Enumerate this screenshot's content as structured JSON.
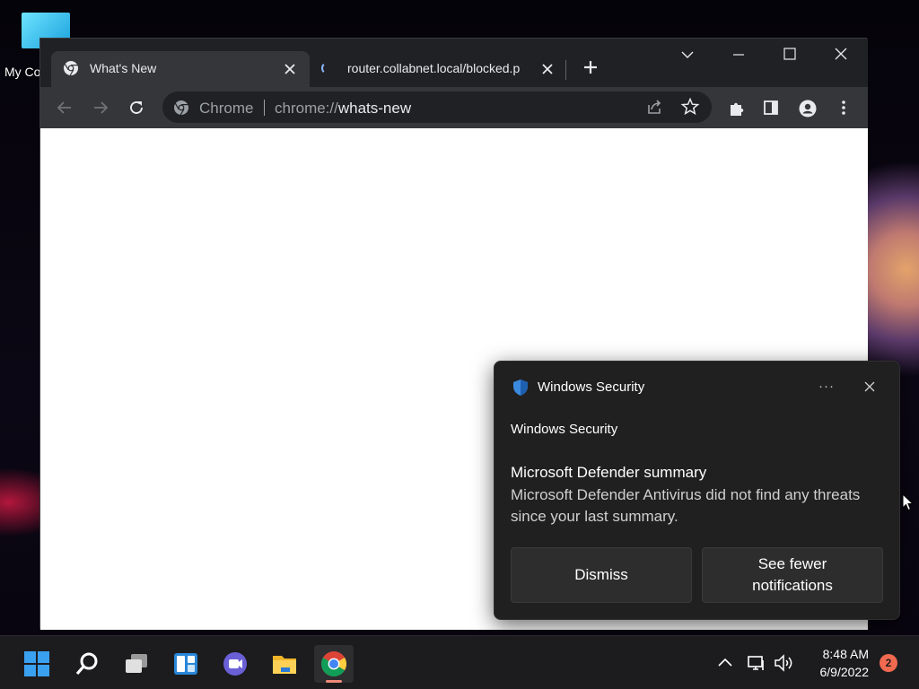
{
  "desktop": {
    "icon_label": "My Co"
  },
  "browser": {
    "tabs": [
      {
        "title": "What's New",
        "active": true
      },
      {
        "title": "router.collabnet.local/blocked.p",
        "active": false
      }
    ],
    "omnibox": {
      "chip": "Chrome",
      "url_scheme": "chrome://",
      "url_host": "whats-new"
    }
  },
  "notification": {
    "app_name": "Windows Security",
    "source": "Windows Security",
    "headline": "Microsoft Defender summary",
    "body": "Microsoft Defender Antivirus did not find any threats since your last summary.",
    "more_label": "···",
    "buttons": {
      "dismiss": "Dismiss",
      "fewer": "See fewer notifications"
    }
  },
  "taskbar": {
    "apps": [
      "start-icon",
      "search-icon",
      "task-view-icon",
      "widgets-icon",
      "chat-icon",
      "file-explorer-icon",
      "chrome-icon"
    ],
    "clock": {
      "time": "8:48 AM",
      "date": "6/9/2022"
    },
    "notification_count": "2"
  },
  "colors": {
    "accent": "#8ab4f8",
    "toast_bg": "#202020",
    "badge": "#f06a50"
  }
}
